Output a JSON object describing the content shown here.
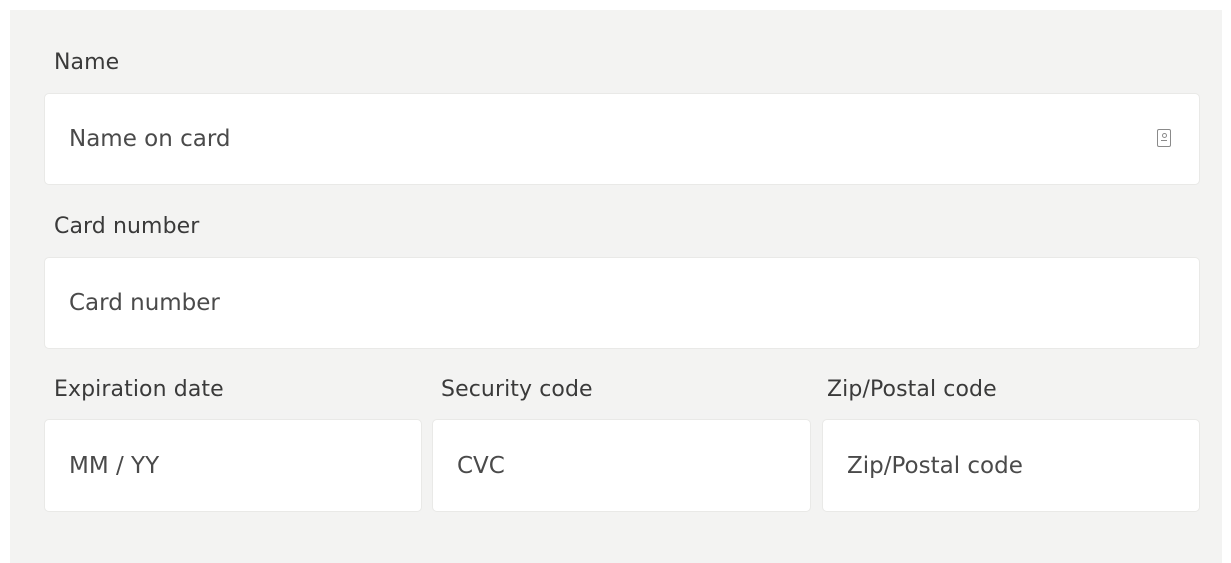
{
  "form": {
    "name": {
      "label": "Name",
      "placeholder": "Name on card",
      "value": "",
      "icon": "contact-card-icon"
    },
    "card_number": {
      "label": "Card number",
      "placeholder": "Card number",
      "value": ""
    },
    "expiration": {
      "label": "Expiration date",
      "placeholder": "MM / YY",
      "value": ""
    },
    "security_code": {
      "label": "Security code",
      "placeholder": "CVC",
      "value": ""
    },
    "zip": {
      "label": "Zip/Postal code",
      "placeholder": "Zip/Postal code",
      "value": ""
    }
  },
  "colors": {
    "panel_background": "#f3f3f2",
    "field_background": "#ffffff",
    "text": "#3a3a3a"
  }
}
